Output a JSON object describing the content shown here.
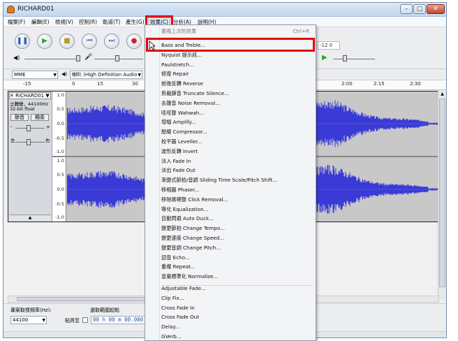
{
  "window": {
    "title": "RICHARD01",
    "controls": [
      "–",
      "□",
      "✕"
    ]
  },
  "menubar": {
    "items": [
      "檔案(F)",
      "編輯(E)",
      "檢視(V)",
      "控制(R)",
      "軌道(T)",
      "產生(G)",
      "效果(C)",
      "分析(A)",
      "說明(H)"
    ]
  },
  "toolbar": {
    "transport": {
      "pause": "❚❚",
      "play": "▶",
      "stop": "■",
      "skip_start": "⏮",
      "skip_end": "⏭",
      "record": "●"
    },
    "meter_text": "-12  0",
    "mic_icon": "mic-icon"
  },
  "device": {
    "host": "MME",
    "output_device": "喇叭 (High Definition Audio"
  },
  "ruler": {
    "ticks": [
      "-15",
      "0",
      "15",
      "30",
      "2:00",
      "2:15",
      "2:30"
    ]
  },
  "track": {
    "name": "RICHARD01",
    "info": [
      "立體聲，44100Hz",
      "32-bit float"
    ],
    "mute_label": "靜音",
    "solo_label": "獨奏",
    "gain_labels": [
      "-",
      "+"
    ],
    "pan_labels": [
      "左",
      "右"
    ],
    "collapse_icon": "▲",
    "axis_top": [
      "1.0",
      "0.5",
      "0.0",
      "-0.5",
      "-1.0"
    ],
    "axis_bottom": [
      "1.0",
      "0.5",
      "0.0",
      "-0.5",
      "-1.0"
    ],
    "wave_color": "#3a3ad6"
  },
  "bottom": {
    "rate_label": "專案取樣頻率(Hz):",
    "rate_value": "44100",
    "selection_label": "選取範圍起點",
    "snap_label": "貼齊至",
    "time_value": "00 h 00 m 00.000"
  },
  "dropdown": {
    "repeat_label": "重複上次的效果",
    "repeat_shortcut": "Ctrl+R",
    "items": [
      "Bass and Treble...",
      "Nyquist 提示訊...",
      "Paulstretch...",
      "修復 Repair",
      "前後反轉 Reverse",
      "剪裁靜音 Truncate Silence...",
      "去雜音 Noise Removal...",
      "哇哇聲 Wahwah...",
      "增幅 Amplify...",
      "壓縮 Compressor...",
      "校平器 Leveller...",
      "波形反轉 Invert",
      "淡入 Fade In",
      "淡出 Fade Out",
      "漸變式節拍/音調 Sliding Time Scale/Pitch Shift...",
      "移相器 Phaser...",
      "移除喀嚓聲 Click Removal...",
      "等化 Equalization...",
      "自動閃避 Auto Duck...",
      "變更節拍 Change Tempo...",
      "變更速度 Change Speed...",
      "變更音調 Change Pitch...",
      "迴音 Echo...",
      "重複 Repeat...",
      "音量標準化 Normalize..."
    ],
    "plugins": [
      "Adjustable Fade...",
      "Clip Fix...",
      "Cross Fade In",
      "Cross Fade Out",
      "Delay...",
      "GVerb..."
    ]
  },
  "accent": {
    "highlight_box": "#e8000d",
    "record_red": "#d0262a",
    "play_green": "#2aa52a",
    "pause_blue": "#2b5fc8"
  }
}
